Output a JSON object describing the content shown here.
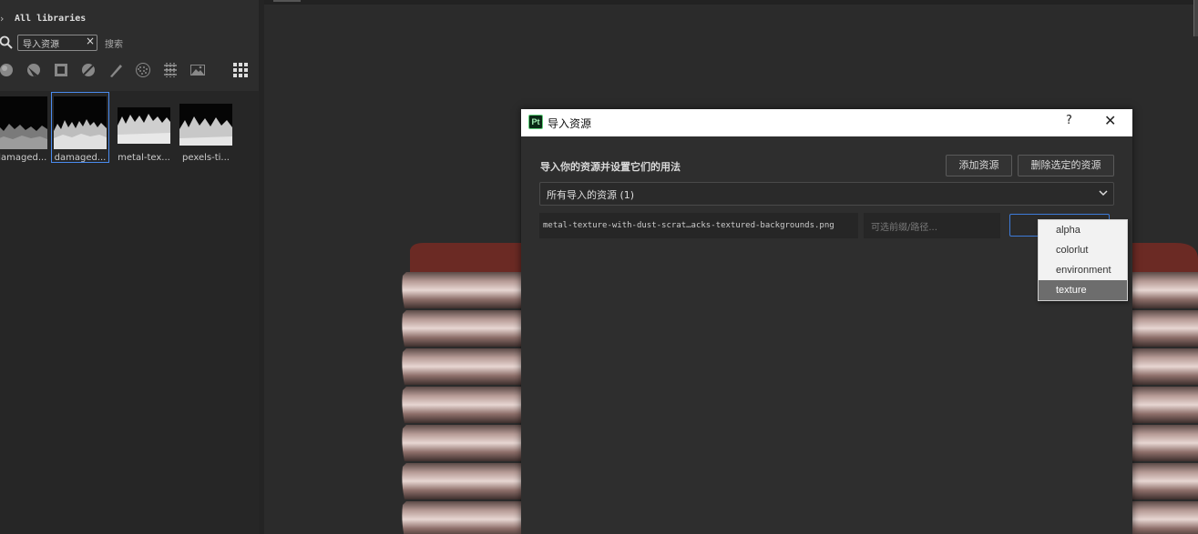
{
  "library": {
    "title": "All libraries",
    "search_value": "导入资源",
    "search_button": "搜索",
    "filter_icons": [
      "material-icon",
      "smart-material-icon",
      "smart-mask-icon",
      "filter-icon",
      "brush-icon",
      "particles-icon",
      "texture-alpha-icon",
      "environment-icon",
      "grid-view-icon"
    ],
    "thumbnails": [
      {
        "label": "damaged...",
        "selected": false
      },
      {
        "label": "damaged...",
        "selected": true
      },
      {
        "label": "metal-tex...",
        "selected": false
      },
      {
        "label": "pexels-ti...",
        "selected": false
      }
    ]
  },
  "dialog": {
    "title": "导入资源",
    "help": "?",
    "close": "✕",
    "heading": "导入你的资源并设置它们的用法",
    "add_button": "添加资源",
    "delete_button": "删除选定的资源",
    "filter_value": "所有导入的资源 (1)",
    "asset": {
      "filename": "metal-texture-with-dust-scrat…acks-textured-backgrounds.png",
      "path_placeholder": "可选前缀/路径..."
    },
    "usage_options": [
      "alpha",
      "colorlut",
      "environment",
      "texture"
    ],
    "usage_selected": "texture"
  },
  "colors": {
    "accent": "#3d7bd9",
    "selection_outline": "#4a8cf0",
    "app_icon_green": "#5fd07a"
  }
}
